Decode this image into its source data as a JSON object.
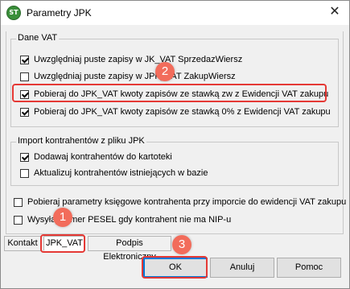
{
  "window": {
    "title": "Parametry JPK",
    "icon": "jpk-app-icon",
    "close_glyph": "✕"
  },
  "dane_vat": {
    "label": "Dane VAT",
    "items": [
      {
        "label": "Uwzględniaj puste zapisy w JK_VAT SprzedazWiersz",
        "checked": true
      },
      {
        "label": "Uwzględniaj puste zapisy w JPK_VAT ZakupWiersz",
        "checked": false
      },
      {
        "label": "Pobieraj do JPK_VAT kwoty zapisów ze stawką zw z Ewidencji VAT zakupu",
        "checked": true
      },
      {
        "label": "Pobieraj do JPK_VAT kwoty zapisów ze stawką 0% z Ewidencji VAT zakupu",
        "checked": true
      }
    ]
  },
  "import": {
    "label": "Import kontrahentów z pliku JPK",
    "items": [
      {
        "label": "Dodawaj kontrahentów do kartoteki",
        "checked": true
      },
      {
        "label": "Aktualizuj kontrahentów istniejących w bazie",
        "checked": false
      }
    ]
  },
  "outer": {
    "items": [
      {
        "label": "Pobieraj parametry księgowe kontrahenta przy imporcie do ewidencji VAT zakupu",
        "checked": false
      },
      {
        "label": "Wysyłaj numer PESEL gdy kontrahent nie ma NIP-u",
        "checked": false
      }
    ]
  },
  "tabs": [
    {
      "label": "Kontakt",
      "active": false
    },
    {
      "label": "JPK_VAT",
      "active": true
    },
    {
      "label": "Podpis Elektroniczny",
      "active": false
    }
  ],
  "buttons": {
    "ok": "OK",
    "cancel": "Anuluj",
    "help": "Pomoc"
  },
  "annotations": {
    "step1": "1",
    "step2": "2",
    "step3": "3",
    "color": "#e53935"
  }
}
